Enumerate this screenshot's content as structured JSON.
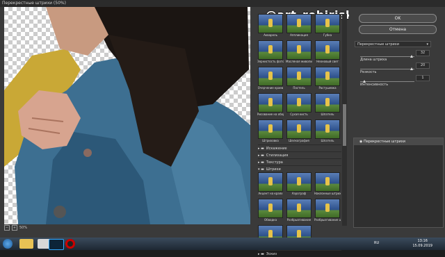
{
  "window": {
    "title": "Перекрестные штрихи (50%)"
  },
  "watermark": "@art_robiriska",
  "zoom": {
    "minus": "−",
    "plus": "+",
    "value": "50%"
  },
  "gallery": {
    "thumbs": [
      {
        "label": "Акварель"
      },
      {
        "label": "Аппликация"
      },
      {
        "label": "Губка"
      },
      {
        "label": "Зернистость фотопленки"
      },
      {
        "label": "Масляная живопись"
      },
      {
        "label": "Неоновый свет"
      },
      {
        "label": "Очерчение краев"
      },
      {
        "label": "Пастель"
      },
      {
        "label": "Растушевка"
      },
      {
        "label": "Рисование на обороте"
      },
      {
        "label": "Сухая кисть"
      },
      {
        "label": "Шпатель"
      },
      {
        "label": "Штриховка"
      },
      {
        "label": "Шелкография"
      },
      {
        "label": "Шпатель"
      }
    ],
    "folders": [
      {
        "label": "Искажение"
      },
      {
        "label": "Стилизация"
      },
      {
        "label": "Текстура"
      },
      {
        "label": "Штрихи"
      }
    ],
    "strokes": [
      {
        "label": "Акцент на краях"
      },
      {
        "label": "Аэрограф"
      },
      {
        "label": "Наклонные штрихи"
      },
      {
        "label": "Обводка"
      },
      {
        "label": "Разбрызгивание"
      },
      {
        "label": "Разбрызгивание штрихов"
      },
      {
        "label": "Сумиэ"
      },
      {
        "label": "Темные штрихи"
      }
    ],
    "bottom_folder": "Эскиз"
  },
  "right": {
    "ok": "OK",
    "cancel": "Отмена",
    "filter_select": "Перекрестные штрихи",
    "params": [
      {
        "label": "Длина штриха",
        "value": "32",
        "level": 0.95
      },
      {
        "label": "Резкость",
        "value": "20",
        "level": 0.95
      },
      {
        "label": "Интенсивность",
        "value": "1",
        "level": 0.05
      }
    ],
    "layer": "Перекрестные штрихи"
  },
  "taskbar": {
    "lang": "RU",
    "time": "13:16",
    "date": "15.09.2019"
  },
  "colors": {
    "accent": "#4a4a4a",
    "panel": "#3a3a3a",
    "jacket": "#3c6e8f"
  }
}
